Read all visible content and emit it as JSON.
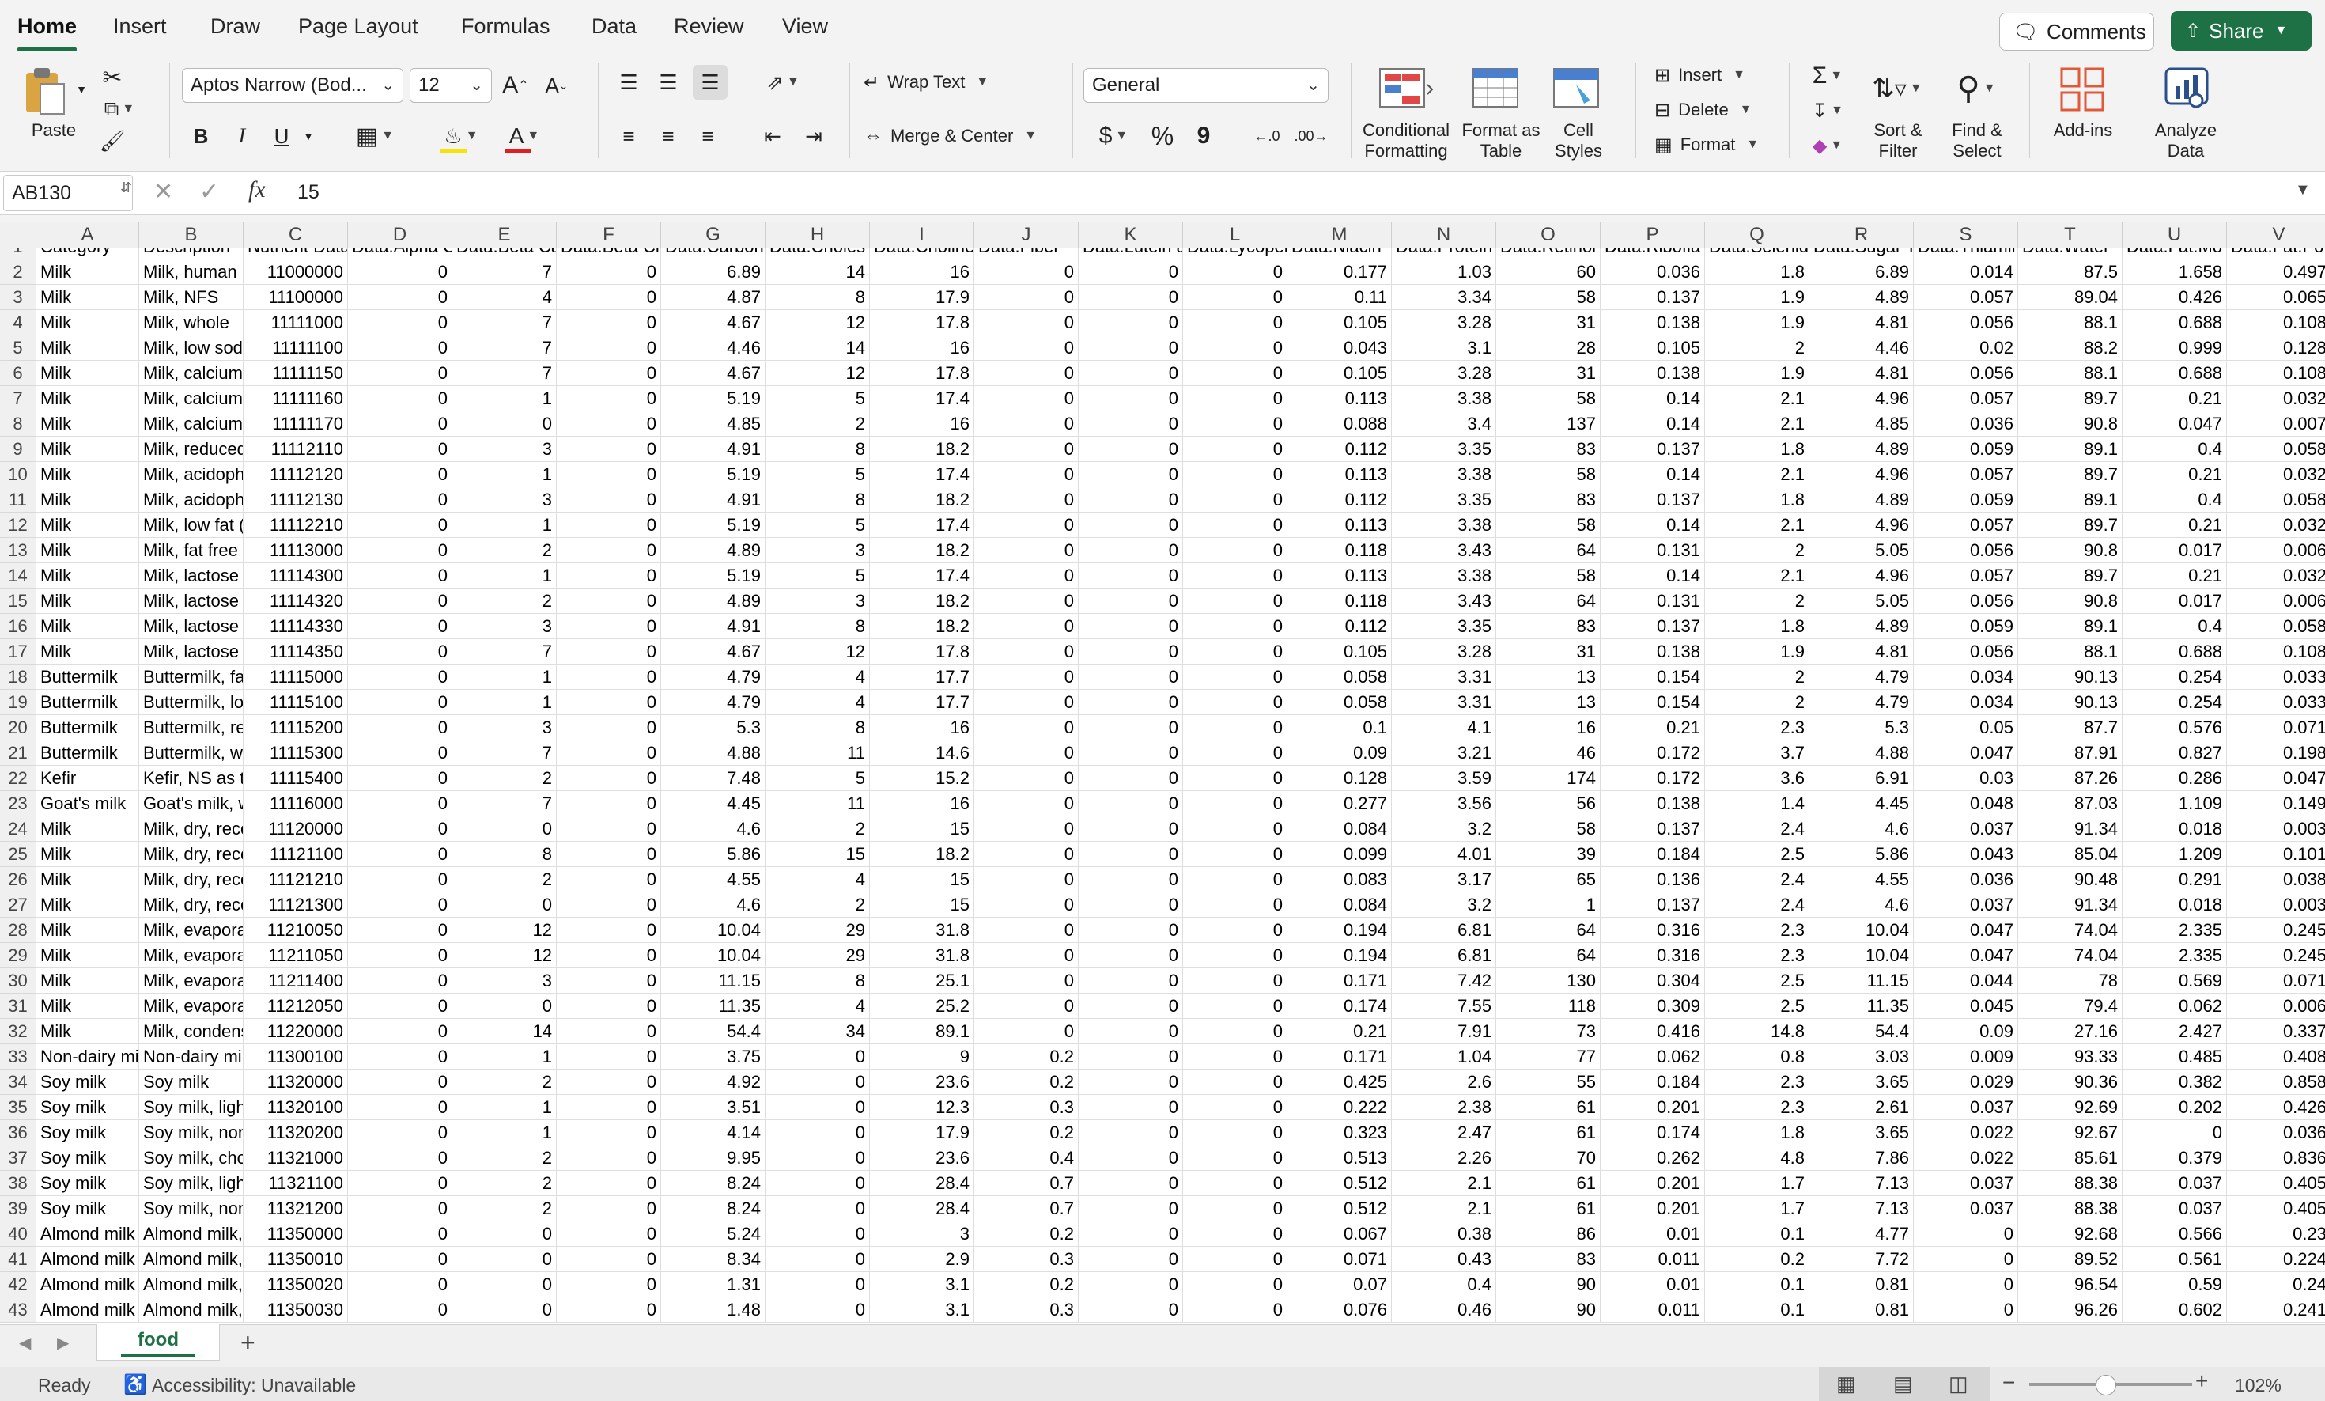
{
  "menu_tabs": [
    "Home",
    "Insert",
    "Draw",
    "Page Layout",
    "Formulas",
    "Data",
    "Review",
    "View"
  ],
  "comments_label": "Comments",
  "share_label": "Share",
  "ribbon": {
    "paste": "Paste",
    "font_name": "Aptos Narrow (Bod...",
    "font_size": "12",
    "wrap_text": "Wrap Text",
    "merge_center": "Merge & Center",
    "number_format": "General",
    "conditional_formatting": "Conditional Formatting",
    "format_as_table": "Format as Table",
    "cell_styles": "Cell Styles",
    "insert": "Insert",
    "delete": "Delete",
    "format": "Format",
    "sort_filter": "Sort & Filter",
    "find_select": "Find & Select",
    "add_ins": "Add-ins",
    "analyze_data": "Analyze Data",
    "bold": "B",
    "italic": "I",
    "underline": "U",
    "currency": "$",
    "percent": "%",
    "comma": "9"
  },
  "formula_bar": {
    "name_box": "AB130",
    "fx": "fx",
    "value": "15"
  },
  "columns": [
    "A",
    "B",
    "C",
    "D",
    "E",
    "F",
    "G",
    "H",
    "I",
    "J",
    "K",
    "L",
    "M",
    "N",
    "O",
    "P",
    "Q",
    "R",
    "S",
    "T",
    "U",
    "V"
  ],
  "header_row": [
    "Category",
    "Description",
    "Nutrient Data",
    "Data.Alpha C",
    "Data.Beta Ca",
    "Data.Beta Cr",
    "Data.Carbon",
    "Data.Choles",
    "Data.Choline",
    "Data.Fiber",
    "Data.Lutein a",
    "Data.Lycopen",
    "Data.Niacin",
    "Data.Protein",
    "Data.Retinol",
    "Data.Ribofla",
    "Data.Selenid",
    "Data.Sugar T",
    "Data.Thiamin",
    "Data.Water",
    "Data.Fat.Mo",
    "Data.Fat.Po"
  ],
  "rows": [
    {
      "n": "2",
      "c": [
        "Milk",
        "Milk, human",
        "11000000",
        "0",
        "7",
        "0",
        "6.89",
        "14",
        "16",
        "0",
        "0",
        "0",
        "0.177",
        "1.03",
        "60",
        "0.036",
        "1.8",
        "6.89",
        "0.014",
        "87.5",
        "1.658",
        "0.497"
      ]
    },
    {
      "n": "3",
      "c": [
        "Milk",
        "Milk, NFS",
        "11100000",
        "0",
        "4",
        "0",
        "4.87",
        "8",
        "17.9",
        "0",
        "0",
        "0",
        "0.11",
        "3.34",
        "58",
        "0.137",
        "1.9",
        "4.89",
        "0.057",
        "89.04",
        "0.426",
        "0.065"
      ]
    },
    {
      "n": "4",
      "c": [
        "Milk",
        "Milk, whole",
        "11111000",
        "0",
        "7",
        "0",
        "4.67",
        "12",
        "17.8",
        "0",
        "0",
        "0",
        "0.105",
        "3.28",
        "31",
        "0.138",
        "1.9",
        "4.81",
        "0.056",
        "88.1",
        "0.688",
        "0.108"
      ]
    },
    {
      "n": "5",
      "c": [
        "Milk",
        "Milk, low sodi",
        "11111100",
        "0",
        "7",
        "0",
        "4.46",
        "14",
        "16",
        "0",
        "0",
        "0",
        "0.043",
        "3.1",
        "28",
        "0.105",
        "2",
        "4.46",
        "0.02",
        "88.2",
        "0.999",
        "0.128"
      ]
    },
    {
      "n": "6",
      "c": [
        "Milk",
        "Milk, calcium",
        "11111150",
        "0",
        "7",
        "0",
        "4.67",
        "12",
        "17.8",
        "0",
        "0",
        "0",
        "0.105",
        "3.28",
        "31",
        "0.138",
        "1.9",
        "4.81",
        "0.056",
        "88.1",
        "0.688",
        "0.108"
      ]
    },
    {
      "n": "7",
      "c": [
        "Milk",
        "Milk, calcium",
        "11111160",
        "0",
        "1",
        "0",
        "5.19",
        "5",
        "17.4",
        "0",
        "0",
        "0",
        "0.113",
        "3.38",
        "58",
        "0.14",
        "2.1",
        "4.96",
        "0.057",
        "89.7",
        "0.21",
        "0.032"
      ]
    },
    {
      "n": "8",
      "c": [
        "Milk",
        "Milk, calcium",
        "11111170",
        "0",
        "0",
        "0",
        "4.85",
        "2",
        "16",
        "0",
        "0",
        "0",
        "0.088",
        "3.4",
        "137",
        "0.14",
        "2.1",
        "4.85",
        "0.036",
        "90.8",
        "0.047",
        "0.007"
      ]
    },
    {
      "n": "9",
      "c": [
        "Milk",
        "Milk, reduced",
        "11112110",
        "0",
        "3",
        "0",
        "4.91",
        "8",
        "18.2",
        "0",
        "0",
        "0",
        "0.112",
        "3.35",
        "83",
        "0.137",
        "1.8",
        "4.89",
        "0.059",
        "89.1",
        "0.4",
        "0.058"
      ]
    },
    {
      "n": "10",
      "c": [
        "Milk",
        "Milk, acidoph",
        "11112120",
        "0",
        "1",
        "0",
        "5.19",
        "5",
        "17.4",
        "0",
        "0",
        "0",
        "0.113",
        "3.38",
        "58",
        "0.14",
        "2.1",
        "4.96",
        "0.057",
        "89.7",
        "0.21",
        "0.032"
      ]
    },
    {
      "n": "11",
      "c": [
        "Milk",
        "Milk, acidoph",
        "11112130",
        "0",
        "3",
        "0",
        "4.91",
        "8",
        "18.2",
        "0",
        "0",
        "0",
        "0.112",
        "3.35",
        "83",
        "0.137",
        "1.8",
        "4.89",
        "0.059",
        "89.1",
        "0.4",
        "0.058"
      ]
    },
    {
      "n": "12",
      "c": [
        "Milk",
        "Milk, low fat (",
        "11112210",
        "0",
        "1",
        "0",
        "5.19",
        "5",
        "17.4",
        "0",
        "0",
        "0",
        "0.113",
        "3.38",
        "58",
        "0.14",
        "2.1",
        "4.96",
        "0.057",
        "89.7",
        "0.21",
        "0.032"
      ]
    },
    {
      "n": "13",
      "c": [
        "Milk",
        "Milk, fat free (",
        "11113000",
        "0",
        "2",
        "0",
        "4.89",
        "3",
        "18.2",
        "0",
        "0",
        "0",
        "0.118",
        "3.43",
        "64",
        "0.131",
        "2",
        "5.05",
        "0.056",
        "90.8",
        "0.017",
        "0.006"
      ]
    },
    {
      "n": "14",
      "c": [
        "Milk",
        "Milk, lactose",
        "11114300",
        "0",
        "1",
        "0",
        "5.19",
        "5",
        "17.4",
        "0",
        "0",
        "0",
        "0.113",
        "3.38",
        "58",
        "0.14",
        "2.1",
        "4.96",
        "0.057",
        "89.7",
        "0.21",
        "0.032"
      ]
    },
    {
      "n": "15",
      "c": [
        "Milk",
        "Milk, lactose",
        "11114320",
        "0",
        "2",
        "0",
        "4.89",
        "3",
        "18.2",
        "0",
        "0",
        "0",
        "0.118",
        "3.43",
        "64",
        "0.131",
        "2",
        "5.05",
        "0.056",
        "90.8",
        "0.017",
        "0.006"
      ]
    },
    {
      "n": "16",
      "c": [
        "Milk",
        "Milk, lactose",
        "11114330",
        "0",
        "3",
        "0",
        "4.91",
        "8",
        "18.2",
        "0",
        "0",
        "0",
        "0.112",
        "3.35",
        "83",
        "0.137",
        "1.8",
        "4.89",
        "0.059",
        "89.1",
        "0.4",
        "0.058"
      ]
    },
    {
      "n": "17",
      "c": [
        "Milk",
        "Milk, lactose",
        "11114350",
        "0",
        "7",
        "0",
        "4.67",
        "12",
        "17.8",
        "0",
        "0",
        "0",
        "0.105",
        "3.28",
        "31",
        "0.138",
        "1.9",
        "4.81",
        "0.056",
        "88.1",
        "0.688",
        "0.108"
      ]
    },
    {
      "n": "18",
      "c": [
        "Buttermilk",
        "Buttermilk, fa",
        "11115000",
        "0",
        "1",
        "0",
        "4.79",
        "4",
        "17.7",
        "0",
        "0",
        "0",
        "0.058",
        "3.31",
        "13",
        "0.154",
        "2",
        "4.79",
        "0.034",
        "90.13",
        "0.254",
        "0.033"
      ]
    },
    {
      "n": "19",
      "c": [
        "Buttermilk",
        "Buttermilk, lo",
        "11115100",
        "0",
        "1",
        "0",
        "4.79",
        "4",
        "17.7",
        "0",
        "0",
        "0",
        "0.058",
        "3.31",
        "13",
        "0.154",
        "2",
        "4.79",
        "0.034",
        "90.13",
        "0.254",
        "0.033"
      ]
    },
    {
      "n": "20",
      "c": [
        "Buttermilk",
        "Buttermilk, re",
        "11115200",
        "0",
        "3",
        "0",
        "5.3",
        "8",
        "16",
        "0",
        "0",
        "0",
        "0.1",
        "4.1",
        "16",
        "0.21",
        "2.3",
        "5.3",
        "0.05",
        "87.7",
        "0.576",
        "0.071"
      ]
    },
    {
      "n": "21",
      "c": [
        "Buttermilk",
        "Buttermilk, w",
        "11115300",
        "0",
        "7",
        "0",
        "4.88",
        "11",
        "14.6",
        "0",
        "0",
        "0",
        "0.09",
        "3.21",
        "46",
        "0.172",
        "3.7",
        "4.88",
        "0.047",
        "87.91",
        "0.827",
        "0.198"
      ]
    },
    {
      "n": "22",
      "c": [
        "Kefir",
        "Kefir, NS as to",
        "11115400",
        "0",
        "2",
        "0",
        "7.48",
        "5",
        "15.2",
        "0",
        "0",
        "0",
        "0.128",
        "3.59",
        "174",
        "0.172",
        "3.6",
        "6.91",
        "0.03",
        "87.26",
        "0.286",
        "0.047"
      ]
    },
    {
      "n": "23",
      "c": [
        "Goat's milk",
        "Goat's milk, w",
        "11116000",
        "0",
        "7",
        "0",
        "4.45",
        "11",
        "16",
        "0",
        "0",
        "0",
        "0.277",
        "3.56",
        "56",
        "0.138",
        "1.4",
        "4.45",
        "0.048",
        "87.03",
        "1.109",
        "0.149"
      ]
    },
    {
      "n": "24",
      "c": [
        "Milk",
        "Milk, dry, reco",
        "11120000",
        "0",
        "0",
        "0",
        "4.6",
        "2",
        "15",
        "0",
        "0",
        "0",
        "0.084",
        "3.2",
        "58",
        "0.137",
        "2.4",
        "4.6",
        "0.037",
        "91.34",
        "0.018",
        "0.003"
      ]
    },
    {
      "n": "25",
      "c": [
        "Milk",
        "Milk, dry, reco",
        "11121100",
        "0",
        "8",
        "0",
        "5.86",
        "15",
        "18.2",
        "0",
        "0",
        "0",
        "0.099",
        "4.01",
        "39",
        "0.184",
        "2.5",
        "5.86",
        "0.043",
        "85.04",
        "1.209",
        "0.101"
      ]
    },
    {
      "n": "26",
      "c": [
        "Milk",
        "Milk, dry, reco",
        "11121210",
        "0",
        "2",
        "0",
        "4.55",
        "4",
        "15",
        "0",
        "0",
        "0",
        "0.083",
        "3.17",
        "65",
        "0.136",
        "2.4",
        "4.55",
        "0.036",
        "90.48",
        "0.291",
        "0.038"
      ]
    },
    {
      "n": "27",
      "c": [
        "Milk",
        "Milk, dry, reco",
        "11121300",
        "0",
        "0",
        "0",
        "4.6",
        "2",
        "15",
        "0",
        "0",
        "0",
        "0.084",
        "3.2",
        "1",
        "0.137",
        "2.4",
        "4.6",
        "0.037",
        "91.34",
        "0.018",
        "0.003"
      ]
    },
    {
      "n": "28",
      "c": [
        "Milk",
        "Milk, evapora",
        "11210050",
        "0",
        "12",
        "0",
        "10.04",
        "29",
        "31.8",
        "0",
        "0",
        "0",
        "0.194",
        "6.81",
        "64",
        "0.316",
        "2.3",
        "10.04",
        "0.047",
        "74.04",
        "2.335",
        "0.245"
      ]
    },
    {
      "n": "29",
      "c": [
        "Milk",
        "Milk, evapora",
        "11211050",
        "0",
        "12",
        "0",
        "10.04",
        "29",
        "31.8",
        "0",
        "0",
        "0",
        "0.194",
        "6.81",
        "64",
        "0.316",
        "2.3",
        "10.04",
        "0.047",
        "74.04",
        "2.335",
        "0.245"
      ]
    },
    {
      "n": "30",
      "c": [
        "Milk",
        "Milk, evapora",
        "11211400",
        "0",
        "3",
        "0",
        "11.15",
        "8",
        "25.1",
        "0",
        "0",
        "0",
        "0.171",
        "7.42",
        "130",
        "0.304",
        "2.5",
        "11.15",
        "0.044",
        "78",
        "0.569",
        "0.071"
      ]
    },
    {
      "n": "31",
      "c": [
        "Milk",
        "Milk, evapora",
        "11212050",
        "0",
        "0",
        "0",
        "11.35",
        "4",
        "25.2",
        "0",
        "0",
        "0",
        "0.174",
        "7.55",
        "118",
        "0.309",
        "2.5",
        "11.35",
        "0.045",
        "79.4",
        "0.062",
        "0.006"
      ]
    },
    {
      "n": "32",
      "c": [
        "Milk",
        "Milk, condens",
        "11220000",
        "0",
        "14",
        "0",
        "54.4",
        "34",
        "89.1",
        "0",
        "0",
        "0",
        "0.21",
        "7.91",
        "73",
        "0.416",
        "14.8",
        "54.4",
        "0.09",
        "27.16",
        "2.427",
        "0.337"
      ]
    },
    {
      "n": "33",
      "c": [
        "Non-dairy mi",
        "Non-dairy mi",
        "11300100",
        "0",
        "1",
        "0",
        "3.75",
        "0",
        "9",
        "0.2",
        "0",
        "0",
        "0.171",
        "1.04",
        "77",
        "0.062",
        "0.8",
        "3.03",
        "0.009",
        "93.33",
        "0.485",
        "0.408"
      ]
    },
    {
      "n": "34",
      "c": [
        "Soy milk",
        "Soy milk",
        "11320000",
        "0",
        "2",
        "0",
        "4.92",
        "0",
        "23.6",
        "0.2",
        "0",
        "0",
        "0.425",
        "2.6",
        "55",
        "0.184",
        "2.3",
        "3.65",
        "0.029",
        "90.36",
        "0.382",
        "0.858"
      ]
    },
    {
      "n": "35",
      "c": [
        "Soy milk",
        "Soy milk, light",
        "11320100",
        "0",
        "1",
        "0",
        "3.51",
        "0",
        "12.3",
        "0.3",
        "0",
        "0",
        "0.222",
        "2.38",
        "61",
        "0.201",
        "2.3",
        "2.61",
        "0.037",
        "92.69",
        "0.202",
        "0.426"
      ]
    },
    {
      "n": "36",
      "c": [
        "Soy milk",
        "Soy milk, non",
        "11320200",
        "0",
        "1",
        "0",
        "4.14",
        "0",
        "17.9",
        "0.2",
        "0",
        "0",
        "0.323",
        "2.47",
        "61",
        "0.174",
        "1.8",
        "3.65",
        "0.022",
        "92.67",
        "0",
        "0.036"
      ]
    },
    {
      "n": "37",
      "c": [
        "Soy milk",
        "Soy milk, cho",
        "11321000",
        "0",
        "2",
        "0",
        "9.95",
        "0",
        "23.6",
        "0.4",
        "0",
        "0",
        "0.513",
        "2.26",
        "70",
        "0.262",
        "4.8",
        "7.86",
        "0.022",
        "85.61",
        "0.379",
        "0.836"
      ]
    },
    {
      "n": "38",
      "c": [
        "Soy milk",
        "Soy milk, light",
        "11321100",
        "0",
        "2",
        "0",
        "8.24",
        "0",
        "28.4",
        "0.7",
        "0",
        "0",
        "0.512",
        "2.1",
        "61",
        "0.201",
        "1.7",
        "7.13",
        "0.037",
        "88.38",
        "0.037",
        "0.405"
      ]
    },
    {
      "n": "39",
      "c": [
        "Soy milk",
        "Soy milk, non",
        "11321200",
        "0",
        "2",
        "0",
        "8.24",
        "0",
        "28.4",
        "0.7",
        "0",
        "0",
        "0.512",
        "2.1",
        "61",
        "0.201",
        "1.7",
        "7.13",
        "0.037",
        "88.38",
        "0.037",
        "0.405"
      ]
    },
    {
      "n": "40",
      "c": [
        "Almond milk",
        "Almond milk,",
        "11350000",
        "0",
        "0",
        "0",
        "5.24",
        "0",
        "3",
        "0.2",
        "0",
        "0",
        "0.067",
        "0.38",
        "86",
        "0.01",
        "0.1",
        "4.77",
        "0",
        "92.68",
        "0.566",
        "0.23"
      ]
    },
    {
      "n": "41",
      "c": [
        "Almond milk",
        "Almond milk,",
        "11350010",
        "0",
        "0",
        "0",
        "8.34",
        "0",
        "2.9",
        "0.3",
        "0",
        "0",
        "0.071",
        "0.43",
        "83",
        "0.011",
        "0.2",
        "7.72",
        "0",
        "89.52",
        "0.561",
        "0.224"
      ]
    },
    {
      "n": "42",
      "c": [
        "Almond milk",
        "Almond milk,",
        "11350020",
        "0",
        "0",
        "0",
        "1.31",
        "0",
        "3.1",
        "0.2",
        "0",
        "0",
        "0.07",
        "0.4",
        "90",
        "0.01",
        "0.1",
        "0.81",
        "0",
        "96.54",
        "0.59",
        "0.24"
      ]
    },
    {
      "n": "43",
      "c": [
        "Almond milk",
        "Almond milk,",
        "11350030",
        "0",
        "0",
        "0",
        "1.48",
        "0",
        "3.1",
        "0.3",
        "0",
        "0",
        "0.076",
        "0.46",
        "90",
        "0.011",
        "0.1",
        "0.81",
        "0",
        "96.26",
        "0.602",
        "0.241"
      ]
    }
  ],
  "sheet_tab": "food",
  "status": {
    "ready": "Ready",
    "accessibility": "Accessibility: Unavailable",
    "zoom": "102%"
  }
}
